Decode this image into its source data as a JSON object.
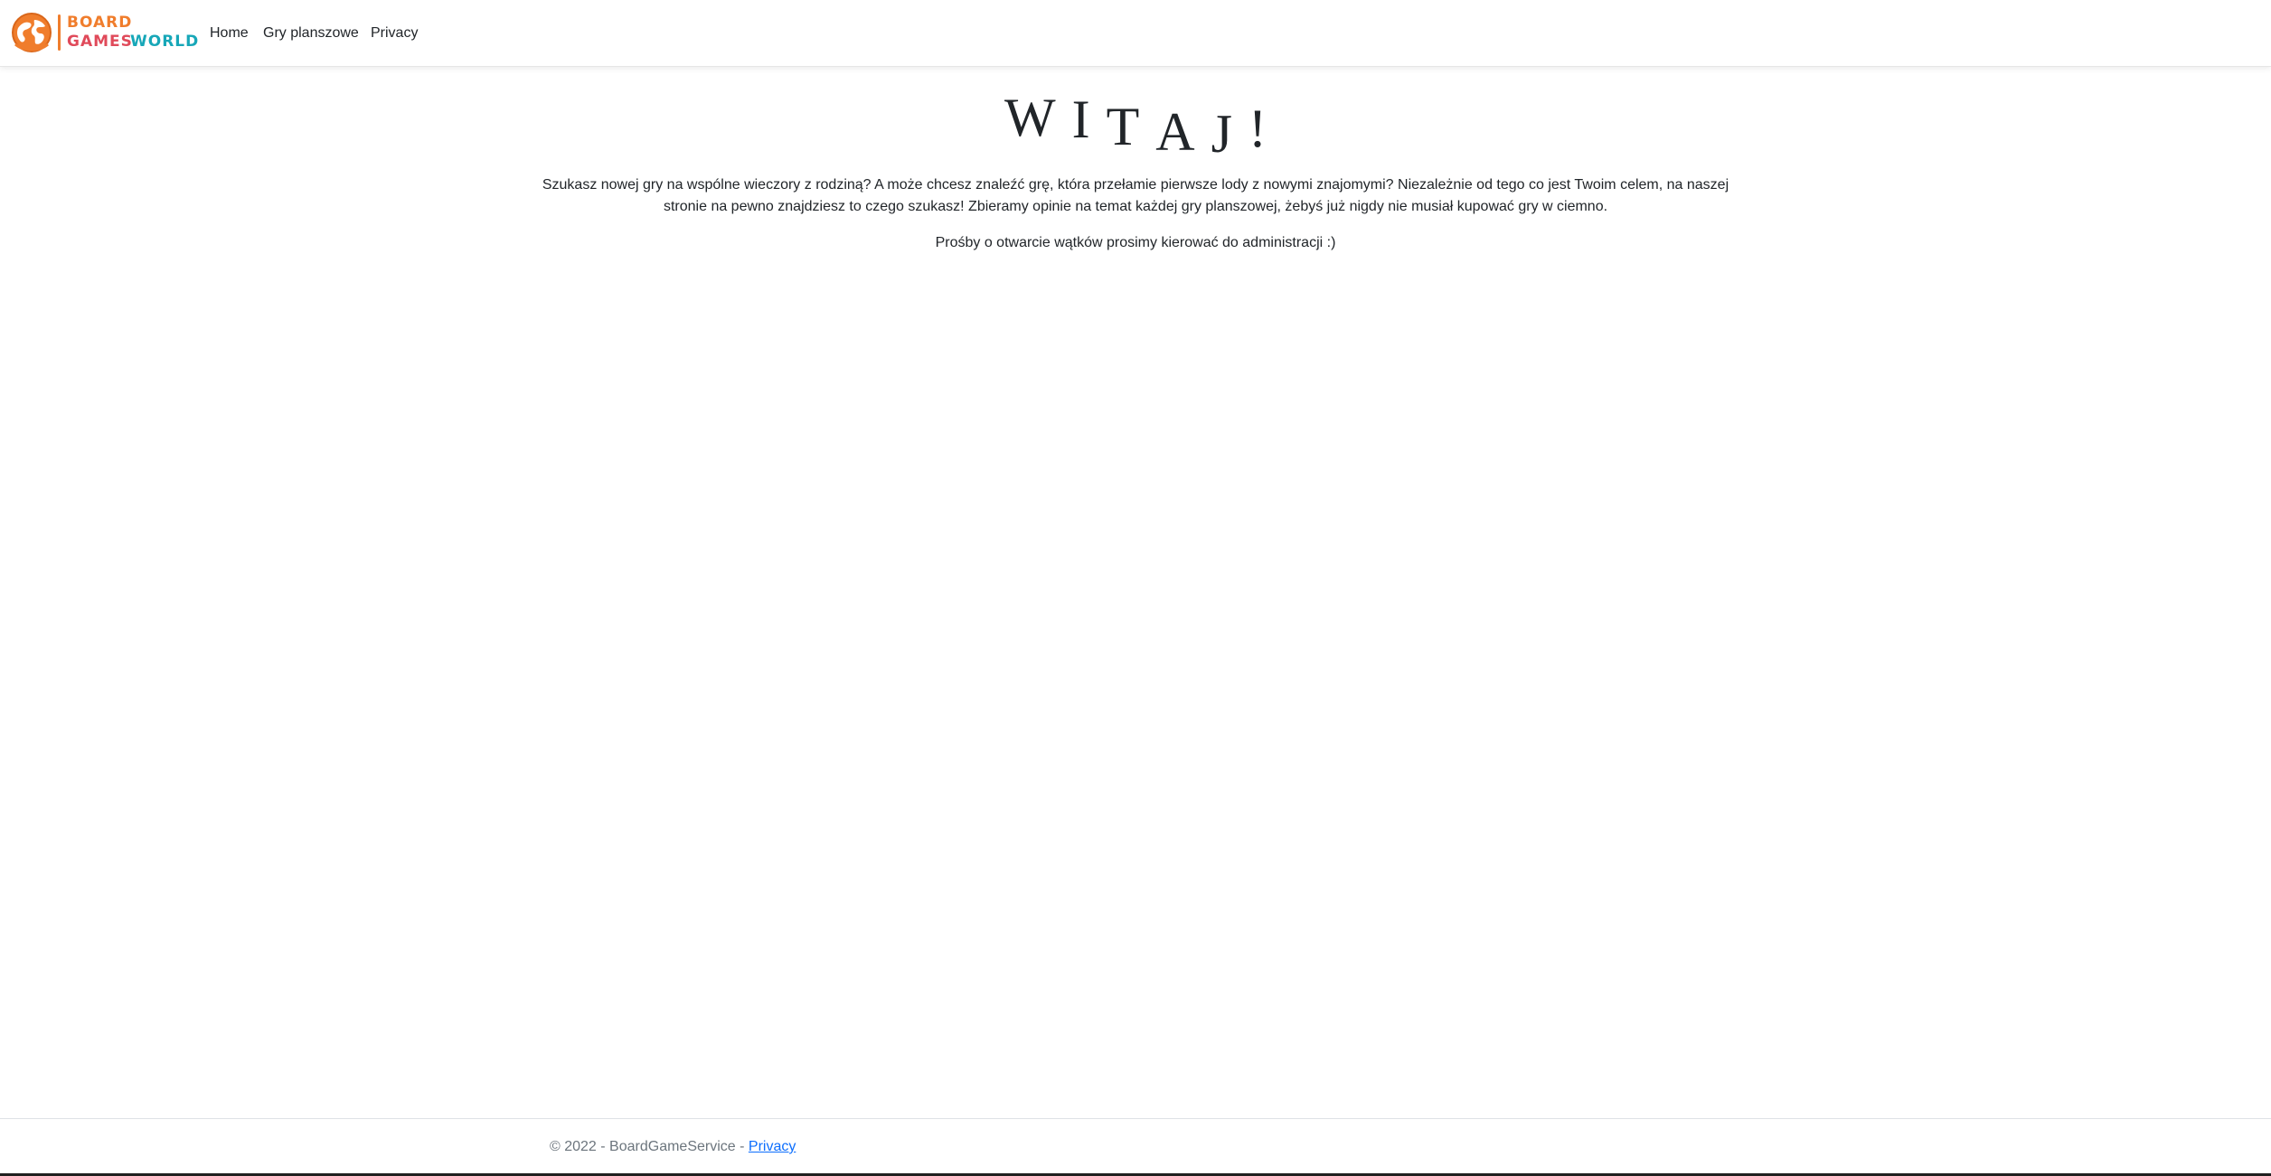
{
  "brand": {
    "name": "Board Games World",
    "line1": "BOARD",
    "line2a": "GAMES",
    "line2b": "WORLD",
    "icon": "globe-logo-icon",
    "colors": {
      "orange": "#f07d2c",
      "red": "#e04a5a",
      "teal": "#17a7b8",
      "yellow": "#f3b12a",
      "pink": "#c94488"
    }
  },
  "nav": {
    "home": "Home",
    "games": "Gry planszowe",
    "privacy": "Privacy"
  },
  "main": {
    "title_chars": [
      "W",
      "I",
      "T",
      "A",
      "J",
      "!"
    ],
    "intro": "Szukasz nowej gry na wspólne wieczory z rodziną? A może chcesz znaleźć grę, która przełamie pierwsze lody z nowymi znajomymi? Niezależnie od tego co jest Twoim celem, na naszej stronie na pewno znajdziesz to czego szukasz! Zbieramy opinie na temat każdej gry planszowej, żebyś już nigdy nie musiał kupować gry w ciemno.",
    "requests": "Prośby o otwarcie wątków prosimy kierować do administracji :)"
  },
  "footer": {
    "copyright": "© 2022 - BoardGameService - ",
    "privacy_link": "Privacy",
    "link_color": "#0d6efd"
  }
}
